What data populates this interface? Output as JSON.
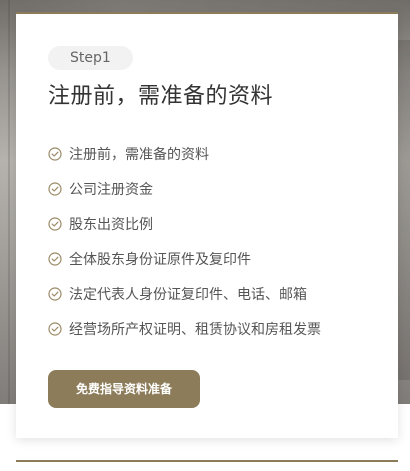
{
  "card": {
    "step_label": "Step1",
    "title": "注册前，需准备的资料",
    "items": [
      {
        "label": "注册前，需准备的资料"
      },
      {
        "label": "公司注册资金"
      },
      {
        "label": "股东出资比例"
      },
      {
        "label": "全体股东身份证原件及复印件"
      },
      {
        "label": "法定代表人身份证复印件、电话、邮箱"
      },
      {
        "label": "经营场所产权证明、租赁协议和房租发票"
      }
    ],
    "cta_label": "免费指导资料准备"
  },
  "colors": {
    "accent": "#8d7c5a",
    "text": "#333333"
  },
  "icons": {
    "list_icon": "check-circle-icon"
  }
}
